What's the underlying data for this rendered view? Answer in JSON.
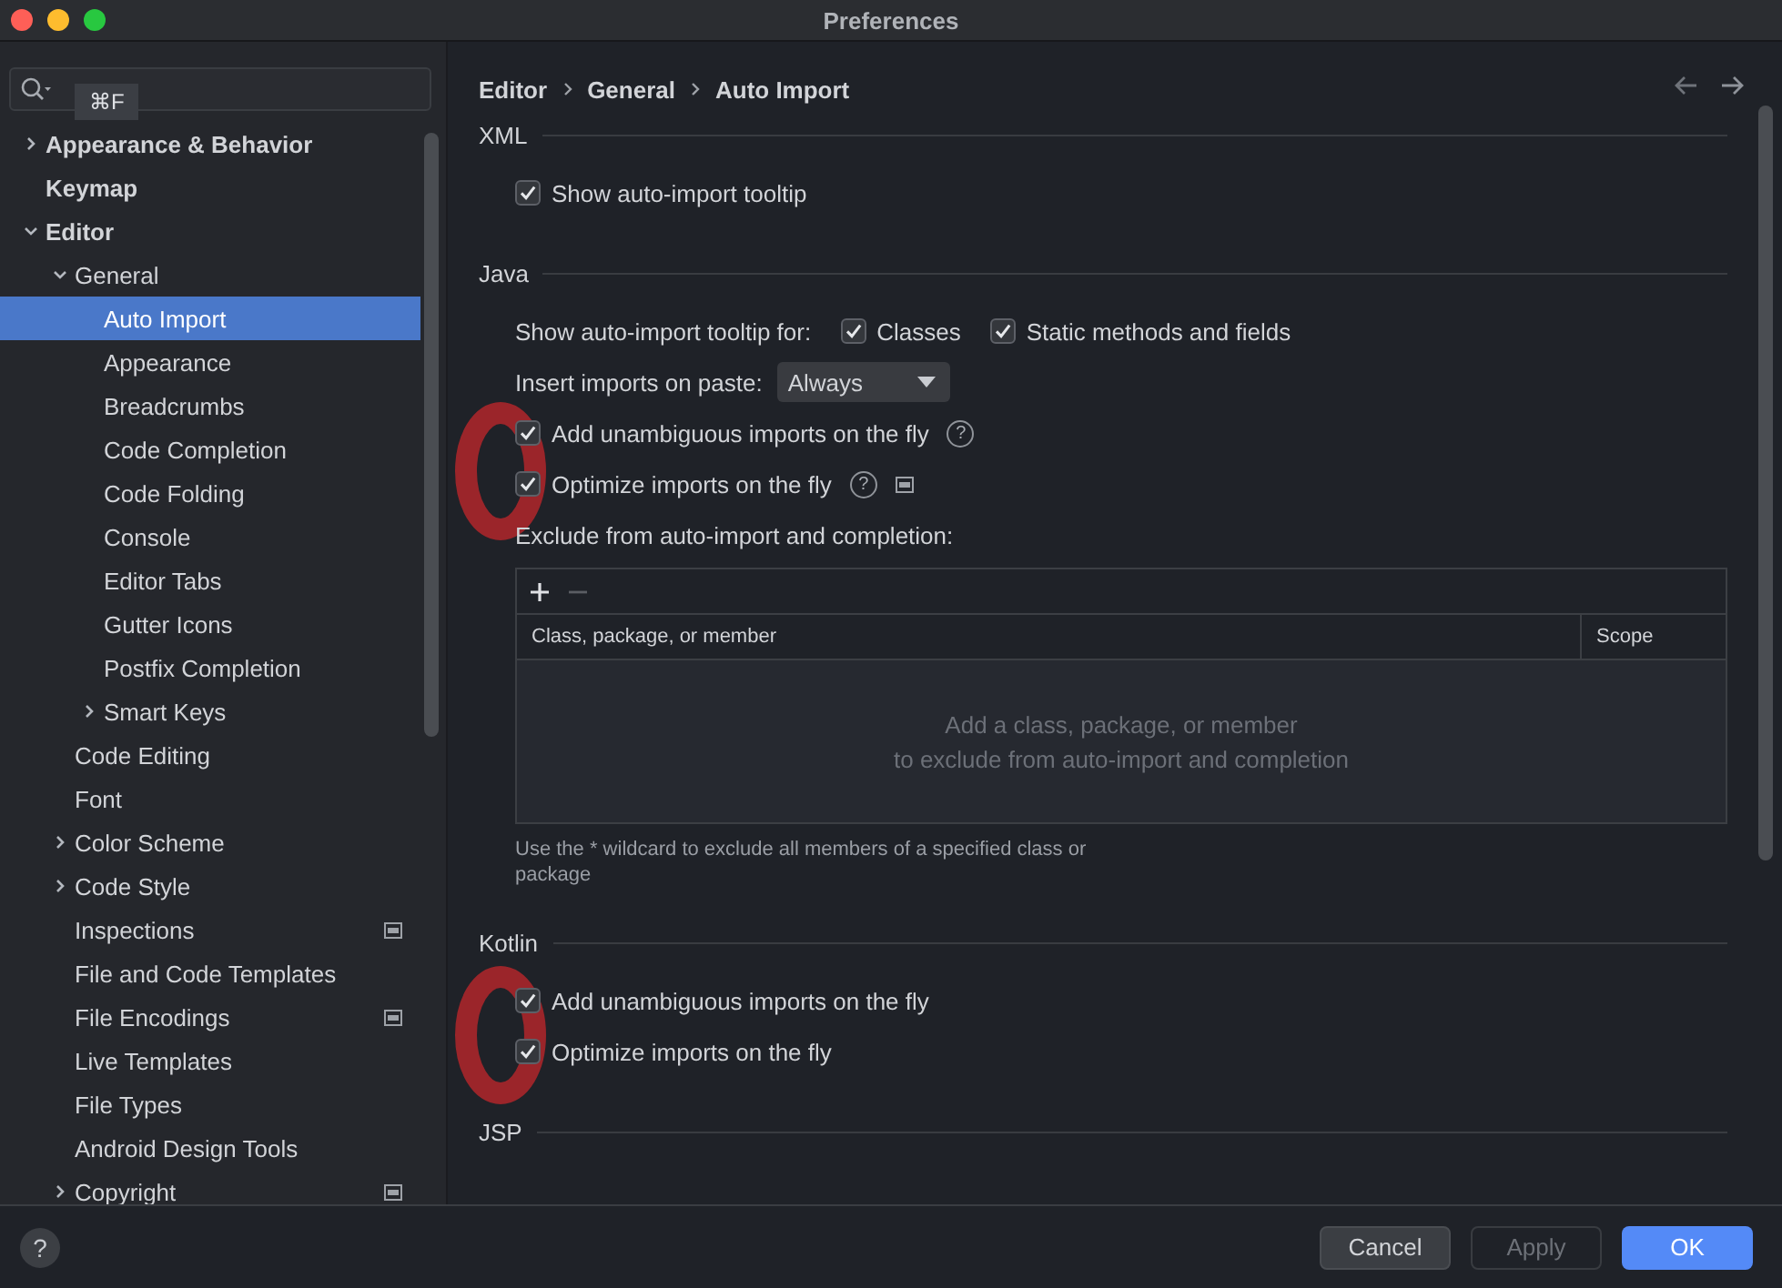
{
  "window": {
    "title": "Preferences"
  },
  "search": {
    "tooltip": "⌘F"
  },
  "tree": {
    "items": [
      {
        "label": "Appearance & Behavior",
        "expanded": false,
        "selected": false
      },
      {
        "label": "Keymap",
        "selected": false
      },
      {
        "label": "Editor",
        "expanded": true,
        "selected": false,
        "children": [
          {
            "label": "General",
            "expanded": true,
            "selected": false,
            "children": [
              {
                "label": "Auto Import",
                "selected": true
              },
              {
                "label": "Appearance",
                "selected": false
              },
              {
                "label": "Breadcrumbs",
                "selected": false
              },
              {
                "label": "Code Completion",
                "selected": false
              },
              {
                "label": "Code Folding",
                "selected": false
              },
              {
                "label": "Console",
                "selected": false
              },
              {
                "label": "Editor Tabs",
                "selected": false
              },
              {
                "label": "Gutter Icons",
                "selected": false
              },
              {
                "label": "Postfix Completion",
                "selected": false
              },
              {
                "label": "Smart Keys",
                "expanded": false,
                "selected": false
              }
            ]
          },
          {
            "label": "Code Editing",
            "selected": false
          },
          {
            "label": "Font",
            "selected": false
          },
          {
            "label": "Color Scheme",
            "expanded": false,
            "selected": false
          },
          {
            "label": "Code Style",
            "expanded": false,
            "selected": false
          },
          {
            "label": "Inspections",
            "project_scoped": true,
            "selected": false
          },
          {
            "label": "File and Code Templates",
            "selected": false
          },
          {
            "label": "File Encodings",
            "project_scoped": true,
            "selected": false
          },
          {
            "label": "Live Templates",
            "selected": false
          },
          {
            "label": "File Types",
            "selected": false
          },
          {
            "label": "Android Design Tools",
            "selected": false
          },
          {
            "label": "Copyright",
            "expanded": false,
            "project_scoped": true,
            "selected": false
          }
        ]
      }
    ]
  },
  "breadcrumbs": [
    "Editor",
    "General",
    "Auto Import"
  ],
  "sections": [
    {
      "title": "XML",
      "rows": [
        {
          "kind": "checkbox",
          "label": "Show auto-import tooltip",
          "checked": true
        }
      ]
    },
    {
      "title": "Java",
      "rows": [
        {
          "kind": "checkbox_group",
          "label": "Show auto-import tooltip for:",
          "options": [
            {
              "label": "Classes",
              "checked": true
            },
            {
              "label": "Static methods and fields",
              "checked": true
            }
          ]
        },
        {
          "kind": "dropdown",
          "label": "Insert imports on paste:",
          "value": "Always"
        },
        {
          "kind": "checkbox",
          "label": "Add unambiguous imports on the fly",
          "checked": true,
          "help": "?"
        },
        {
          "kind": "checkbox",
          "label": "Optimize imports on the fly",
          "checked": true,
          "help": "?",
          "project_scoped": true
        },
        {
          "kind": "label",
          "label": "Exclude from auto-import and completion:"
        },
        {
          "kind": "table",
          "toolbar": [
            {
              "kind": "add",
              "disabled": false
            },
            {
              "kind": "remove",
              "disabled": true
            }
          ],
          "columns": [
            "Class, package, or member",
            "Scope"
          ],
          "empty_text": [
            "Add a class, package, or member",
            "to exclude from auto-import and completion"
          ]
        },
        {
          "kind": "hint",
          "label": "Use the * wildcard to exclude all members of a specified class or package"
        }
      ]
    },
    {
      "title": "Kotlin",
      "rows": [
        {
          "kind": "checkbox",
          "label": "Add unambiguous imports on the fly",
          "checked": true
        },
        {
          "kind": "checkbox",
          "label": "Optimize imports on the fly",
          "checked": true
        }
      ]
    },
    {
      "title": "JSP"
    }
  ],
  "footer": {
    "help": "?",
    "buttons": [
      {
        "label": "Cancel",
        "kind": "secondary",
        "disabled": false
      },
      {
        "label": "Apply",
        "kind": "secondary",
        "disabled": true
      },
      {
        "label": "OK",
        "kind": "primary",
        "disabled": false
      }
    ]
  }
}
